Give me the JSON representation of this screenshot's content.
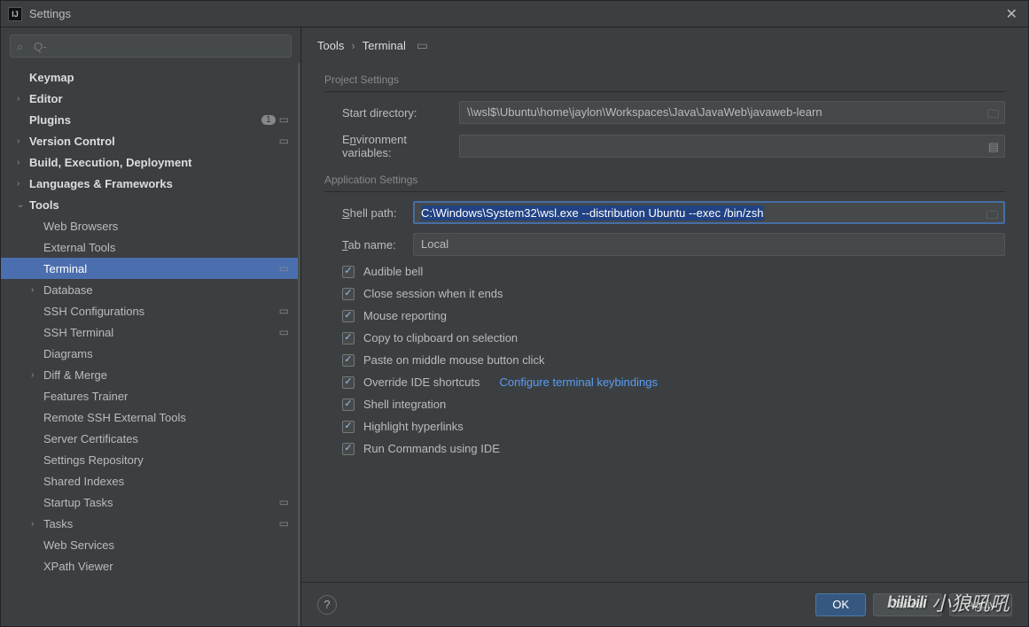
{
  "window": {
    "title": "Settings",
    "app_icon_text": "IJ"
  },
  "search": {
    "placeholder": "Q-"
  },
  "breadcrumb": {
    "items": [
      "Tools",
      "Terminal"
    ]
  },
  "sidebar": {
    "items": [
      {
        "label": "Keymap",
        "chev": "",
        "bold": true,
        "indent": 0
      },
      {
        "label": "Editor",
        "chev": "›",
        "bold": true,
        "indent": 0
      },
      {
        "label": "Plugins",
        "chev": "",
        "bold": true,
        "indent": 0,
        "badge": "1",
        "indicator": true
      },
      {
        "label": "Version Control",
        "chev": "›",
        "bold": true,
        "indent": 0,
        "indicator": true
      },
      {
        "label": "Build, Execution, Deployment",
        "chev": "›",
        "bold": true,
        "indent": 0
      },
      {
        "label": "Languages & Frameworks",
        "chev": "›",
        "bold": true,
        "indent": 0
      },
      {
        "label": "Tools",
        "chev": "⌄",
        "bold": true,
        "indent": 0
      },
      {
        "label": "Web Browsers",
        "chev": "",
        "indent": 1
      },
      {
        "label": "External Tools",
        "chev": "",
        "indent": 1
      },
      {
        "label": "Terminal",
        "chev": "",
        "indent": 1,
        "selected": true,
        "indicator": true
      },
      {
        "label": "Database",
        "chev": "›",
        "indent": 1
      },
      {
        "label": "SSH Configurations",
        "chev": "",
        "indent": 1,
        "indicator": true
      },
      {
        "label": "SSH Terminal",
        "chev": "",
        "indent": 1,
        "indicator": true
      },
      {
        "label": "Diagrams",
        "chev": "",
        "indent": 1
      },
      {
        "label": "Diff & Merge",
        "chev": "›",
        "indent": 1
      },
      {
        "label": "Features Trainer",
        "chev": "",
        "indent": 1
      },
      {
        "label": "Remote SSH External Tools",
        "chev": "",
        "indent": 1
      },
      {
        "label": "Server Certificates",
        "chev": "",
        "indent": 1
      },
      {
        "label": "Settings Repository",
        "chev": "",
        "indent": 1
      },
      {
        "label": "Shared Indexes",
        "chev": "",
        "indent": 1
      },
      {
        "label": "Startup Tasks",
        "chev": "",
        "indent": 1,
        "indicator": true
      },
      {
        "label": "Tasks",
        "chev": "›",
        "indent": 1,
        "indicator": true
      },
      {
        "label": "Web Services",
        "chev": "",
        "indent": 1
      },
      {
        "label": "XPath Viewer",
        "chev": "",
        "indent": 1
      }
    ]
  },
  "sections": {
    "project": "Project Settings",
    "application": "Application Settings"
  },
  "fields": {
    "start_dir_label": "Start directory:",
    "start_dir_value": "\\\\wsl$\\Ubuntu\\home\\jaylon\\Workspaces\\Java\\JavaWeb\\javaweb-learn",
    "env_label_pre": "E",
    "env_label_ul": "n",
    "env_label_post": "vironment variables:",
    "env_value": "",
    "shell_label_ul": "S",
    "shell_label_post": "hell path:",
    "shell_value": "C:\\Windows\\System32\\wsl.exe --distribution Ubuntu --exec /bin/zsh",
    "tab_label_ul": "T",
    "tab_label_post": "ab name:",
    "tab_value": "Local"
  },
  "checks": [
    {
      "label": "Audible bell",
      "on": true
    },
    {
      "label": "Close session when it ends",
      "on": true
    },
    {
      "label": "Mouse reporting",
      "on": true
    },
    {
      "label": "Copy to clipboard on selection",
      "on": true
    },
    {
      "label": "Paste on middle mouse button click",
      "on": true
    },
    {
      "label": "Override IDE shortcuts",
      "on": true,
      "link": "Configure terminal keybindings"
    },
    {
      "label": "Shell integration",
      "on": true
    },
    {
      "label": "Highlight hyperlinks",
      "on": true
    },
    {
      "label": "Run Commands using IDE",
      "on": true
    }
  ],
  "buttons": {
    "ok": "OK",
    "cancel": "Cancel",
    "apply": "Apply"
  },
  "watermark": {
    "logo": "bilibili",
    "text": "小狼吼吼"
  }
}
